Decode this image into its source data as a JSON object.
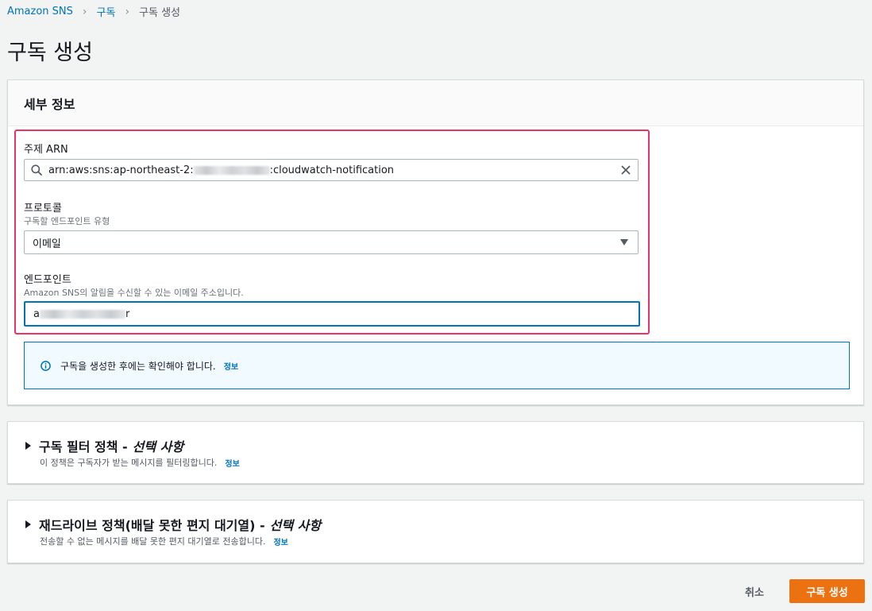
{
  "breadcrumb": {
    "root": "Amazon SNS",
    "parent": "구독",
    "current": "구독 생성"
  },
  "page_title": "구독 생성",
  "details": {
    "header": "세부 정보",
    "topic_arn": {
      "label": "주제 ARN",
      "value_prefix": "arn:aws:sns:ap-northeast-2:",
      "value_suffix": ":cloudwatch-notification"
    },
    "protocol": {
      "label": "프로토콜",
      "description": "구독할 엔드포인트 유형",
      "selected": "이메일"
    },
    "endpoint": {
      "label": "엔드포인트",
      "description": "Amazon SNS의 알림을 수신할 수 있는 이메일 주소입니다.",
      "value_prefix": "a",
      "value_suffix": "r"
    },
    "info_alert": {
      "text": "구독을 생성한 후에는 확인해야 합니다.",
      "link": "정보"
    }
  },
  "filter_policy": {
    "title": "구독 필터 정책 -",
    "optional": "선택 사항",
    "description": "이 정책은 구독자가 받는 메시지를 필터링합니다.",
    "link": "정보"
  },
  "redrive_policy": {
    "title": "재드라이브 정책(배달 못한 편지 대기열) -",
    "optional": "선택 사항",
    "description": "전송할 수 없는 메시지를 배달 못한 편지 대기열로 전송합니다.",
    "link": "정보"
  },
  "actions": {
    "cancel": "취소",
    "create": "구독 생성"
  },
  "colors": {
    "accent_link": "#0073bb",
    "primary_button": "#ec7211",
    "highlight_border": "#e8336b",
    "background": "#f2f3f3"
  }
}
